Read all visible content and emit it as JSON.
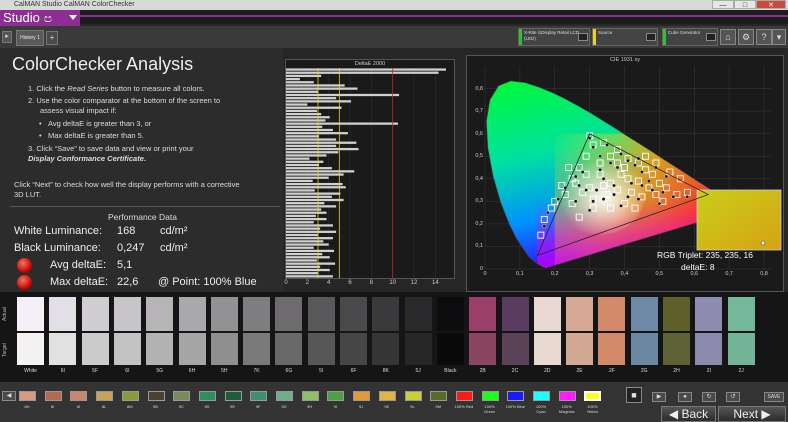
{
  "window": {
    "title": "CalMAN Studio CalMAN ColorChecker",
    "min": "—",
    "max": "□",
    "close": "✕"
  },
  "studio": {
    "label": "Studio",
    "swirl": "ප"
  },
  "toolbar": {
    "tab_label": "History 1",
    "add_tab": "+",
    "devices": [
      {
        "label": "X-Rite i1Display Retail LCD (LED)",
        "color": "#2fbf3a"
      },
      {
        "label": "Source",
        "color": "#e8d321"
      },
      {
        "label": "Cube Generator",
        "color": "#2fbf3a"
      }
    ],
    "buttons": [
      "⌂",
      "⚙",
      "?",
      "▾"
    ]
  },
  "analysis": {
    "title": "ColorChecker Analysis",
    "step1_pre": "1.  Click the ",
    "step1_em": "Read Series",
    "step1_post": " button to measure all colors.",
    "step2_a": "2.  Use the color comparator at the bottom of the screen to",
    "step2_b": "assess visual impact if:",
    "bullet1": "Avg deltaE is greater than 3, or",
    "bullet2": "Max deltaE is greater than 5.",
    "step3_a": "3.  Click “Save” to save data and view or print your",
    "step3_em": "Display Conformance Certificate",
    "step3_post": ".",
    "hint_a": "Click “Next” to check how well the display performs with a corrective",
    "hint_b": "3D LUT.",
    "perf_title": "Performance Data",
    "white_label": "White Luminance:",
    "white_value": "168",
    "white_unit": "cd/m²",
    "black_label": "Black Luminance:",
    "black_value": "0,247",
    "black_unit": "cd/m²",
    "avg_label": "Avg deltaE:",
    "avg_value": "5,1",
    "max_label": "Max deltaE:",
    "max_value": "22,6",
    "point_label": "@ Point: 100% Blue"
  },
  "chart_data": [
    {
      "type": "bar",
      "orientation": "horizontal",
      "title": "DeltaE 2000",
      "xlim": [
        0,
        15
      ],
      "xticks": [
        "0",
        "2",
        "4",
        "6",
        "8",
        "10",
        "12",
        "14"
      ],
      "thresholds": [
        {
          "value": 3,
          "color": "#e8d321"
        },
        {
          "value": 5,
          "color": "#e8d321"
        },
        {
          "value": 10,
          "color": "#cc2222"
        }
      ],
      "values": [
        22.6,
        14.3,
        3.3,
        1.3,
        2.6,
        5.5,
        6.7,
        3.0,
        10.6,
        4.7,
        6.1,
        2.0,
        5.2,
        2.9,
        3.3,
        4.1,
        3.7,
        10.5,
        3.4,
        4.4,
        5.8,
        3.1,
        4.7,
        6.6,
        4.7,
        6.8,
        4.9,
        3.8,
        2.2,
        3.5,
        3.1,
        4.3,
        6.4,
        5.4,
        4.0,
        2.5,
        5.3,
        5.6,
        2.7,
        5.1,
        4.3,
        5.4,
        3.6,
        4.7,
        3.3,
        3.8,
        2.8,
        3.8,
        2.6,
        4.4,
        3.2,
        4.7,
        3.0,
        4.4,
        3.5,
        4.0,
        2.6,
        4.5,
        3.4,
        4.1,
        2.9,
        4.6,
        3.2,
        4.1,
        3.0,
        4.4
      ]
    },
    {
      "type": "scatter",
      "title": "CIE 1931 xy",
      "xlim": [
        0,
        0.82
      ],
      "ylim": [
        0,
        0.9
      ],
      "xticks": [
        "0",
        "0,1",
        "0,2",
        "0,3",
        "0,4",
        "0,5",
        "0,6",
        "0,7",
        "0,8"
      ],
      "yticks": [
        "0",
        "0,1",
        "0,2",
        "0,3",
        "0,4",
        "0,5",
        "0,6",
        "0,7",
        "0,8"
      ],
      "targets": [
        [
          0.3,
          0.59
        ],
        [
          0.31,
          0.55
        ],
        [
          0.29,
          0.5
        ],
        [
          0.34,
          0.56
        ],
        [
          0.38,
          0.53
        ],
        [
          0.41,
          0.49
        ],
        [
          0.44,
          0.47
        ],
        [
          0.46,
          0.44
        ],
        [
          0.48,
          0.42
        ],
        [
          0.36,
          0.5
        ],
        [
          0.38,
          0.47
        ],
        [
          0.4,
          0.45
        ],
        [
          0.33,
          0.47
        ],
        [
          0.27,
          0.45
        ],
        [
          0.29,
          0.42
        ],
        [
          0.25,
          0.4
        ],
        [
          0.22,
          0.37
        ],
        [
          0.23,
          0.33
        ],
        [
          0.2,
          0.3
        ],
        [
          0.19,
          0.27
        ],
        [
          0.17,
          0.22
        ],
        [
          0.16,
          0.15
        ],
        [
          0.25,
          0.29
        ],
        [
          0.28,
          0.34
        ],
        [
          0.33,
          0.42
        ],
        [
          0.36,
          0.38
        ],
        [
          0.41,
          0.4
        ],
        [
          0.44,
          0.39
        ],
        [
          0.47,
          0.36
        ],
        [
          0.5,
          0.38
        ],
        [
          0.52,
          0.36
        ],
        [
          0.55,
          0.33
        ],
        [
          0.58,
          0.34
        ],
        [
          0.62,
          0.32
        ],
        [
          0.64,
          0.33
        ],
        [
          0.51,
          0.3
        ],
        [
          0.45,
          0.32
        ],
        [
          0.42,
          0.34
        ],
        [
          0.38,
          0.35
        ],
        [
          0.35,
          0.33
        ],
        [
          0.4,
          0.29
        ],
        [
          0.43,
          0.27
        ],
        [
          0.36,
          0.27
        ],
        [
          0.31,
          0.31
        ],
        [
          0.3,
          0.36
        ],
        [
          0.34,
          0.37
        ],
        [
          0.26,
          0.38
        ],
        [
          0.24,
          0.45
        ],
        [
          0.49,
          0.47
        ],
        [
          0.53,
          0.43
        ],
        [
          0.56,
          0.4
        ],
        [
          0.46,
          0.5
        ],
        [
          0.39,
          0.42
        ],
        [
          0.31,
          0.27
        ],
        [
          0.27,
          0.23
        ],
        [
          0.49,
          0.33
        ]
      ],
      "measured": [
        [
          0.3,
          0.58
        ],
        [
          0.31,
          0.54
        ],
        [
          0.33,
          0.5
        ],
        [
          0.35,
          0.55
        ],
        [
          0.39,
          0.51
        ],
        [
          0.41,
          0.48
        ],
        [
          0.43,
          0.46
        ],
        [
          0.45,
          0.43
        ],
        [
          0.36,
          0.47
        ],
        [
          0.38,
          0.45
        ],
        [
          0.33,
          0.44
        ],
        [
          0.28,
          0.43
        ],
        [
          0.26,
          0.41
        ],
        [
          0.23,
          0.36
        ],
        [
          0.21,
          0.31
        ],
        [
          0.18,
          0.25
        ],
        [
          0.17,
          0.19
        ],
        [
          0.26,
          0.3
        ],
        [
          0.29,
          0.35
        ],
        [
          0.34,
          0.4
        ],
        [
          0.37,
          0.37
        ],
        [
          0.42,
          0.38
        ],
        [
          0.45,
          0.37
        ],
        [
          0.48,
          0.35
        ],
        [
          0.51,
          0.34
        ],
        [
          0.54,
          0.32
        ],
        [
          0.58,
          0.32
        ],
        [
          0.5,
          0.29
        ],
        [
          0.44,
          0.31
        ],
        [
          0.41,
          0.32
        ],
        [
          0.37,
          0.33
        ],
        [
          0.34,
          0.31
        ],
        [
          0.39,
          0.28
        ],
        [
          0.31,
          0.3
        ],
        [
          0.32,
          0.35
        ],
        [
          0.27,
          0.37
        ],
        [
          0.49,
          0.45
        ],
        [
          0.52,
          0.41
        ],
        [
          0.44,
          0.49
        ],
        [
          0.3,
          0.26
        ],
        [
          0.62,
          0.31
        ],
        [
          0.47,
          0.39
        ]
      ],
      "inset": {
        "triplet_label": "RGB Triplet: 235, 235, 16",
        "delta_label": "deltaE: 8"
      }
    }
  ],
  "comparator": {
    "actual_label": "Actual",
    "target_label": "Target",
    "swatches": [
      {
        "label": "White",
        "actual": "#f4eff6",
        "target": "#f3f1f1"
      },
      {
        "label": "6I",
        "actual": "#e2e0e6",
        "target": "#e1e1e1"
      },
      {
        "label": "5F",
        "actual": "#cfcdd2",
        "target": "#cbcbcb"
      },
      {
        "label": "6I",
        "actual": "#c8c5ca",
        "target": "#c3c3c3"
      },
      {
        "label": "5G",
        "actual": "#b7b4b8",
        "target": "#b3b3b3"
      },
      {
        "label": "6H",
        "actual": "#a9a8ac",
        "target": "#a6a6a6"
      },
      {
        "label": "5H",
        "actual": "#929194",
        "target": "#8f8f8f"
      },
      {
        "label": "7K",
        "actual": "#7e7d80",
        "target": "#7a7a7a"
      },
      {
        "label": "6G",
        "actual": "#6d6b6e",
        "target": "#696969"
      },
      {
        "label": "5I",
        "actual": "#59585a",
        "target": "#575757"
      },
      {
        "label": "6F",
        "actual": "#4a4a4c",
        "target": "#464646"
      },
      {
        "label": "8K",
        "actual": "#3a393c",
        "target": "#363636"
      },
      {
        "label": "5J",
        "actual": "#2a292c",
        "target": "#272727"
      },
      {
        "label": "Black",
        "actual": "#0c0b0d",
        "target": "#0a0a0a"
      },
      {
        "label": "2B",
        "actual": "#9a3f6a",
        "target": "#8a4560"
      },
      {
        "label": "2C",
        "actual": "#5a3a5f",
        "target": "#5a4257"
      },
      {
        "label": "2D",
        "actual": "#e8d7d2",
        "target": "#e7d8d0"
      },
      {
        "label": "2E",
        "actual": "#d6a995",
        "target": "#d2a993"
      },
      {
        "label": "2F",
        "actual": "#d38a6a",
        "target": "#d28a6b"
      },
      {
        "label": "2G",
        "actual": "#6f8aa8",
        "target": "#6a88a2"
      },
      {
        "label": "2H",
        "actual": "#5f5f2a",
        "target": "#5e6236"
      },
      {
        "label": "2I",
        "actual": "#8f8cb2",
        "target": "#8b8aad"
      },
      {
        "label": "2J",
        "actual": "#74b89a",
        "target": "#72b495"
      }
    ]
  },
  "bottom": {
    "buttons": [
      {
        "label": "8H",
        "color": "#d89a82"
      },
      {
        "label": "8I",
        "color": "#b26a4f"
      },
      {
        "label": "8I",
        "color": "#c9876c"
      },
      {
        "label": "8L",
        "color": "#c6a35a"
      },
      {
        "label": "8M",
        "color": "#8a9a3a"
      },
      {
        "label": "9B",
        "color": "#4a4133"
      },
      {
        "label": "9C",
        "color": "#7a8a5a"
      },
      {
        "label": "9D",
        "color": "#2f8f5a"
      },
      {
        "label": "9E",
        "color": "#1f5a3a"
      },
      {
        "label": "9F",
        "color": "#3f8f6f"
      },
      {
        "label": "9G",
        "color": "#6fae8a"
      },
      {
        "label": "9H",
        "color": "#8fbf6a"
      },
      {
        "label": "9I",
        "color": "#4f9f4a"
      },
      {
        "label": "9J",
        "color": "#e09a3a"
      },
      {
        "label": "9K",
        "color": "#e1b446"
      },
      {
        "label": "9L",
        "color": "#c7cf3a"
      },
      {
        "label": "9M",
        "color": "#5a6a2a"
      },
      {
        "label": "100% Red",
        "color": "#ff1a1a"
      },
      {
        "label": "100% Green",
        "color": "#1aff1a"
      },
      {
        "label": "100% Blue",
        "color": "#1a1aff"
      },
      {
        "label": "100% Cyan",
        "color": "#1affff"
      },
      {
        "label": "100% Magenta",
        "color": "#ff1aff"
      },
      {
        "label": "100% Yellow",
        "color": "#ffff1a"
      }
    ],
    "stop": "■",
    "back": "Back",
    "next": "Next",
    "save": "SAVE"
  }
}
